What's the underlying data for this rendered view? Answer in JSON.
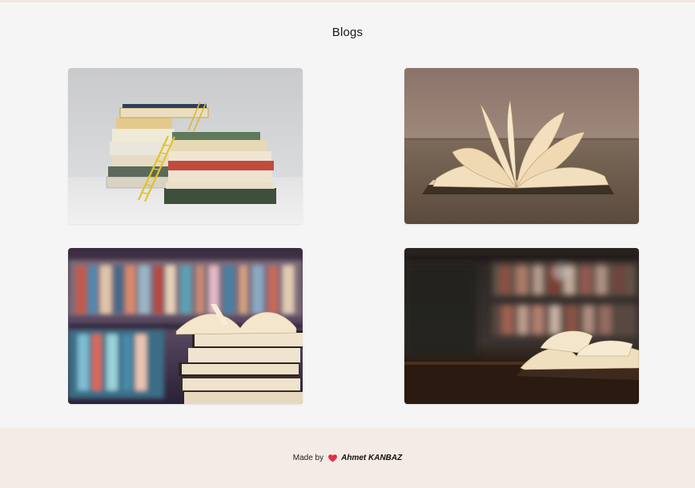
{
  "header": {
    "title": "Blogs"
  },
  "blogs": [
    {
      "image": "stacked-books-with-ladder-image"
    },
    {
      "image": "open-book-on-wooden-table-image"
    },
    {
      "image": "book-stack-library-shelves-image"
    },
    {
      "image": "open-book-dark-library-image"
    }
  ],
  "footer": {
    "made_by": "Made by",
    "icon": "heart-icon",
    "author": "Ahmet KANBAZ",
    "heart_color": "#e0304a"
  }
}
